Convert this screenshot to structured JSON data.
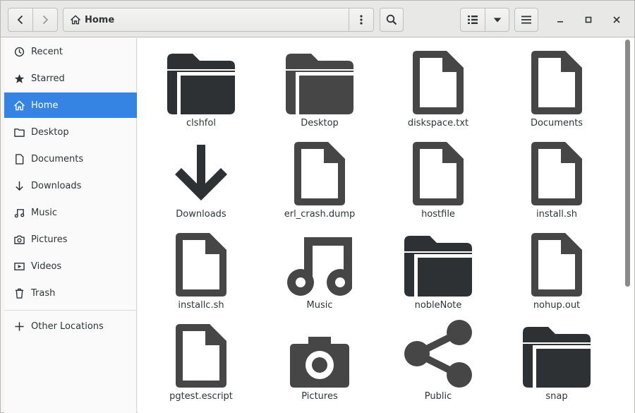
{
  "header": {
    "path_label": "Home"
  },
  "sidebar": {
    "items": [
      {
        "label": "Recent",
        "icon": "clock-icon"
      },
      {
        "label": "Starred",
        "icon": "star-icon"
      },
      {
        "label": "Home",
        "icon": "home-icon",
        "active": true
      },
      {
        "label": "Desktop",
        "icon": "folder-icon"
      },
      {
        "label": "Documents",
        "icon": "document-icon"
      },
      {
        "label": "Downloads",
        "icon": "download-icon"
      },
      {
        "label": "Music",
        "icon": "music-icon"
      },
      {
        "label": "Pictures",
        "icon": "camera-icon"
      },
      {
        "label": "Videos",
        "icon": "video-icon"
      },
      {
        "label": "Trash",
        "icon": "trash-icon"
      }
    ],
    "other_locations": "Other Locations"
  },
  "files": [
    {
      "name": "clshfol",
      "icon": "folder-icon"
    },
    {
      "name": "Desktop",
      "icon": "folder-icon"
    },
    {
      "name": "diskspace.txt",
      "icon": "document-icon"
    },
    {
      "name": "Documents",
      "icon": "document-icon"
    },
    {
      "name": "Downloads",
      "icon": "download-icon"
    },
    {
      "name": "erl_crash.dump",
      "icon": "document-icon"
    },
    {
      "name": "hostfile",
      "icon": "document-icon"
    },
    {
      "name": "install.sh",
      "icon": "document-icon"
    },
    {
      "name": "installc.sh",
      "icon": "document-icon"
    },
    {
      "name": "Music",
      "icon": "music-icon"
    },
    {
      "name": "nobleNote",
      "icon": "folder-icon"
    },
    {
      "name": "nohup.out",
      "icon": "document-icon"
    },
    {
      "name": "pgtest.escript",
      "icon": "document-icon"
    },
    {
      "name": "Pictures",
      "icon": "camera-icon"
    },
    {
      "name": "Public",
      "icon": "share-icon"
    },
    {
      "name": "snap",
      "icon": "folder-icon"
    }
  ],
  "colors": {
    "accent": "#3584e4",
    "icon": "#464646",
    "folder": "#2e3133"
  }
}
